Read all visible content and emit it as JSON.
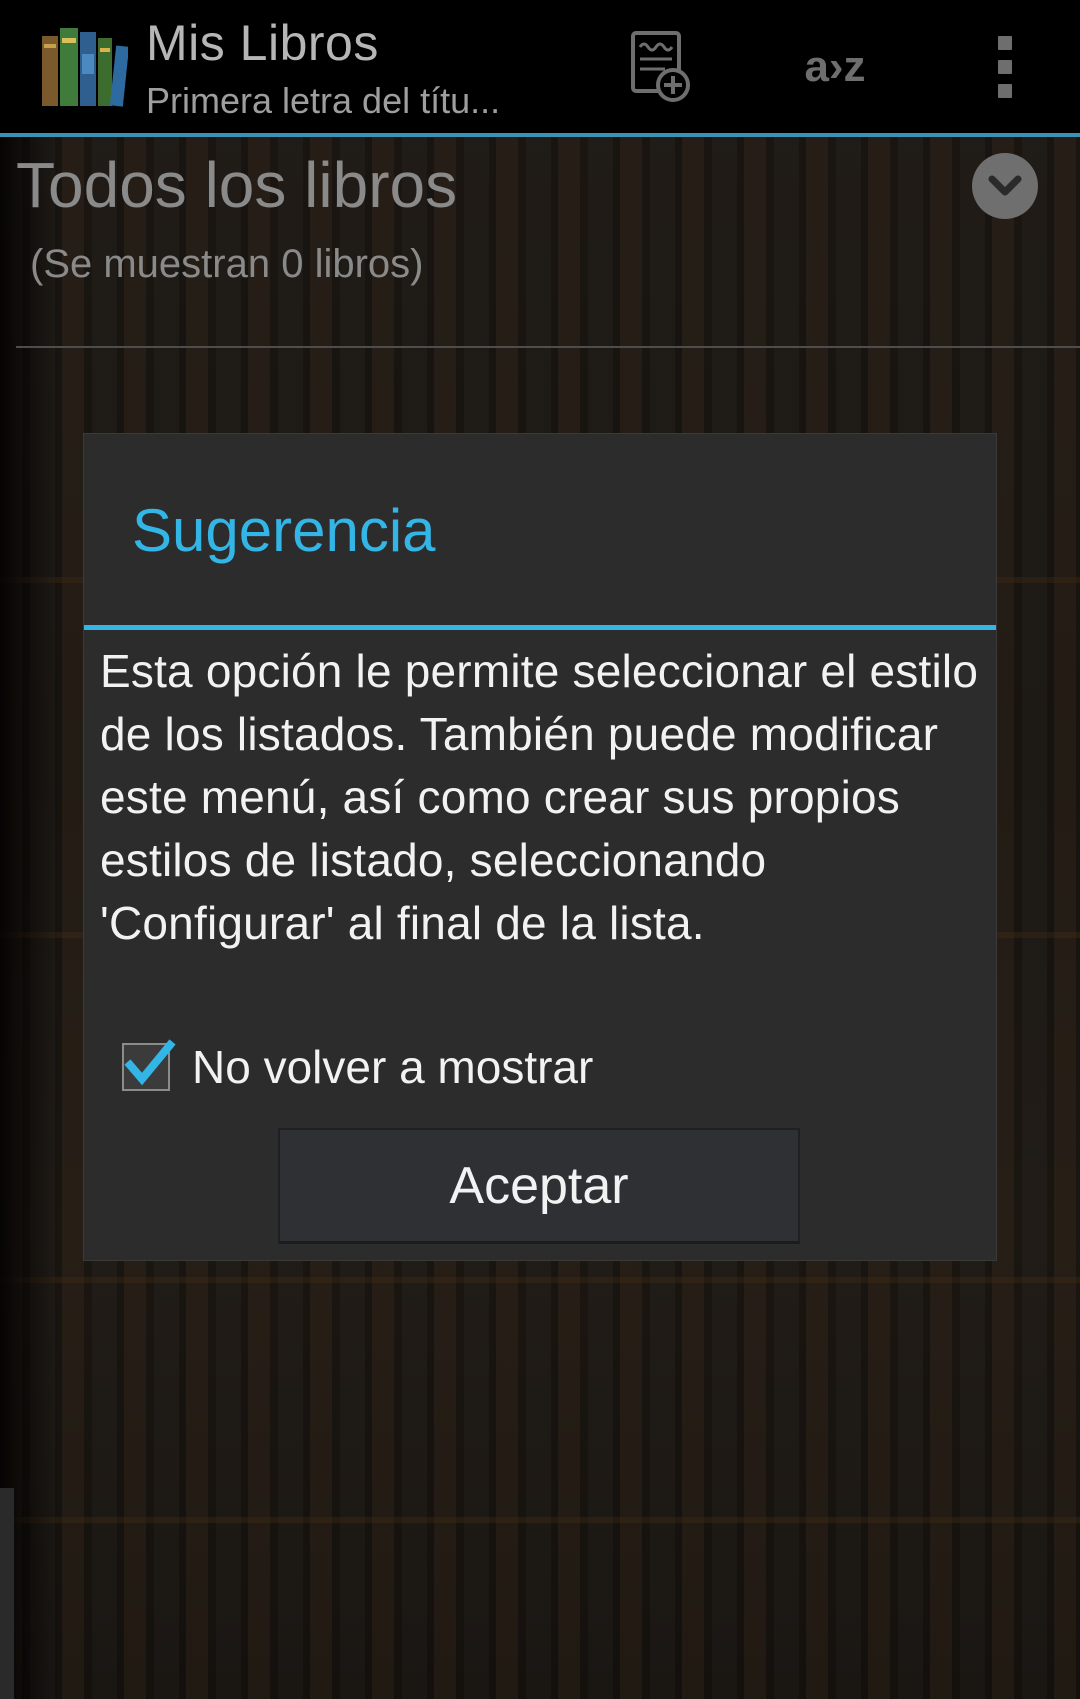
{
  "action_bar": {
    "title": "Mis Libros",
    "subtitle": "Primera letra del títu...",
    "sort_label": "a›z",
    "icons": [
      "books-app-icon",
      "add-book-icon",
      "sort-icon",
      "overflow-menu-icon"
    ]
  },
  "list": {
    "title": "Todos los libros",
    "count": "(Se muestran 0 libros)"
  },
  "dialog": {
    "title": "Sugerencia",
    "message": "Esta opción le permite seleccionar el estilo de los listados. También puede modificar este menú, así como crear sus propios estilos de listado, seleccionando 'Configurar' al final de la lista.",
    "checkbox_label": "No volver a mostrar",
    "checkbox_checked": true,
    "accept_label": "Aceptar"
  },
  "colors": {
    "accent": "#33b5e5",
    "action_bar_divider": "#3a93b6",
    "dialog_background": "#2c2c2c"
  }
}
